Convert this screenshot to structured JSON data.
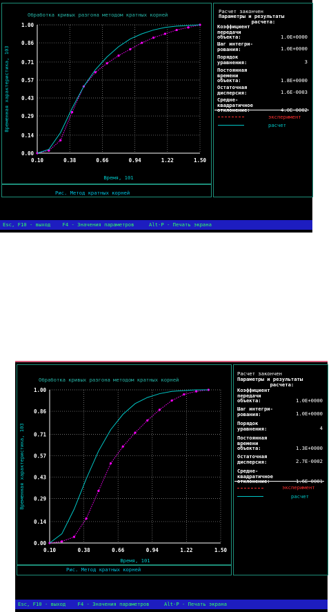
{
  "colors": {
    "experiment": "#ff00ff",
    "calc": "#00c8c8",
    "frame": "#1d8f7a",
    "title": "#27b6a8",
    "legend_exp": "#ff3030",
    "footer_bg": "#1d1dc0",
    "footer_text": "#33ff66",
    "top_bar_2": "#d45a78"
  },
  "screens": [
    {
      "chart_title": "Обработка кривых разгона методом кратных корней",
      "caption": "Рис.  Метод кратных корней",
      "panel": {
        "status": "Расчет закончен",
        "header": "Параметры и результаты\n           расчета:",
        "params": [
          {
            "label": "Коэффициент\nпередачи\nобъекта:",
            "value": "1.0E+0000"
          },
          {
            "label": "Шаг интегри-\nрования:",
            "value": "1.0E+0000"
          },
          {
            "label": "Порядок\nуравнения:",
            "value": "3"
          },
          {
            "label": "Постоянная\nвремени\nобъекта:",
            "value": "1.8E+0000"
          },
          {
            "label": "Остаточная\nдисперсия:",
            "value": "1.6E-0003"
          },
          {
            "label": "Средне-\nквадратичное\nотклонение:",
            "value": "4.0E-0002"
          }
        ],
        "legend": [
          {
            "label": "эксперимент"
          },
          {
            "label": "расчет"
          }
        ]
      },
      "footer": "Esc, F10 - выход    F4 - Значения параметров     Alt-P - Печать экрана"
    },
    {
      "chart_title": "Обработка кривых разгона методом кратных корней",
      "caption": "Рис.  Метод кратных корней",
      "panel": {
        "status": "Расчет закончен",
        "header": "Параметры и результаты\n           расчета:",
        "params": [
          {
            "label": "Коэффициент\nпередачи\nобъекта:",
            "value": "1.0E+0000"
          },
          {
            "label": "Шаг интегри-\nрования:",
            "value": "1.0E+0000"
          },
          {
            "label": "Порядок\nуравнения:",
            "value": "4"
          },
          {
            "label": "Постоянная\nвремени\nобъекта:",
            "value": "1.3E+0000"
          },
          {
            "label": "Остаточная\nдисперсия:",
            "value": "2.7E-0002"
          },
          {
            "label": "Средне-\nквадратичное\nотклонение:",
            "value": "1.6E-0001"
          }
        ],
        "legend": [
          {
            "label": "эксперимент"
          },
          {
            "label": "расчет"
          }
        ]
      },
      "footer": "Esc, F10 - выход    F4 - Значения параметров     Alt-P - Печать экрана"
    }
  ],
  "chart_data": [
    {
      "type": "line",
      "title": "Обработка кривых разгона методом кратных корней",
      "xlabel": "Время, 10^1",
      "ylabel": "Временная характеристика, 10^3",
      "x_ticks": [
        "0.10",
        "0.38",
        "0.66",
        "0.94",
        "1.22",
        "1.50"
      ],
      "y_ticks": [
        "0.00",
        "0.14",
        "0.29",
        "0.43",
        "0.57",
        "0.71",
        "0.86",
        "1.00"
      ],
      "xlim": [
        0.1,
        1.5
      ],
      "ylim": [
        0.0,
        1.0
      ],
      "grid": true,
      "series": [
        {
          "name": "эксперимент",
          "style": "dotted",
          "markers": true,
          "x": [
            0.1,
            0.2,
            0.3,
            0.4,
            0.5,
            0.6,
            0.7,
            0.8,
            0.9,
            1.0,
            1.1,
            1.2,
            1.3,
            1.4,
            1.5
          ],
          "y": [
            0.0,
            0.02,
            0.1,
            0.32,
            0.52,
            0.63,
            0.7,
            0.76,
            0.81,
            0.86,
            0.9,
            0.93,
            0.96,
            0.98,
            1.0
          ]
        },
        {
          "name": "расчет",
          "style": "solid",
          "markers": false,
          "x": [
            0.1,
            0.2,
            0.3,
            0.4,
            0.5,
            0.6,
            0.7,
            0.8,
            0.9,
            1.0,
            1.1,
            1.2,
            1.3,
            1.4,
            1.5
          ],
          "y": [
            0.0,
            0.03,
            0.16,
            0.35,
            0.52,
            0.65,
            0.75,
            0.83,
            0.89,
            0.93,
            0.96,
            0.98,
            0.99,
            0.995,
            1.0
          ]
        }
      ]
    },
    {
      "type": "line",
      "title": "Обработка кривых разгона методом кратных корней",
      "xlabel": "Время, 10^1",
      "ylabel": "Временная характеристика, 10^3",
      "x_ticks": [
        "0.10",
        "0.38",
        "0.66",
        "0.94",
        "1.22",
        "1.50"
      ],
      "y_ticks": [
        "0.00",
        "0.14",
        "0.29",
        "0.43",
        "0.57",
        "0.71",
        "0.86",
        "1.00"
      ],
      "xlim": [
        0.1,
        1.5
      ],
      "ylim": [
        0.0,
        1.0
      ],
      "grid": true,
      "series": [
        {
          "name": "эксперимент",
          "style": "dotted",
          "markers": true,
          "x": [
            0.1,
            0.2,
            0.3,
            0.4,
            0.5,
            0.6,
            0.7,
            0.8,
            0.9,
            1.0,
            1.1,
            1.2,
            1.3,
            1.4
          ],
          "y": [
            0.0,
            0.01,
            0.04,
            0.16,
            0.34,
            0.52,
            0.63,
            0.72,
            0.8,
            0.87,
            0.93,
            0.97,
            0.99,
            1.0
          ]
        },
        {
          "name": "расчет",
          "style": "solid",
          "markers": false,
          "x": [
            0.1,
            0.2,
            0.3,
            0.4,
            0.5,
            0.6,
            0.7,
            0.8,
            0.9,
            1.0,
            1.1,
            1.2,
            1.3,
            1.4
          ],
          "y": [
            0.0,
            0.06,
            0.22,
            0.42,
            0.6,
            0.74,
            0.84,
            0.91,
            0.95,
            0.975,
            0.99,
            0.995,
            1.0,
            1.0
          ]
        }
      ]
    }
  ]
}
